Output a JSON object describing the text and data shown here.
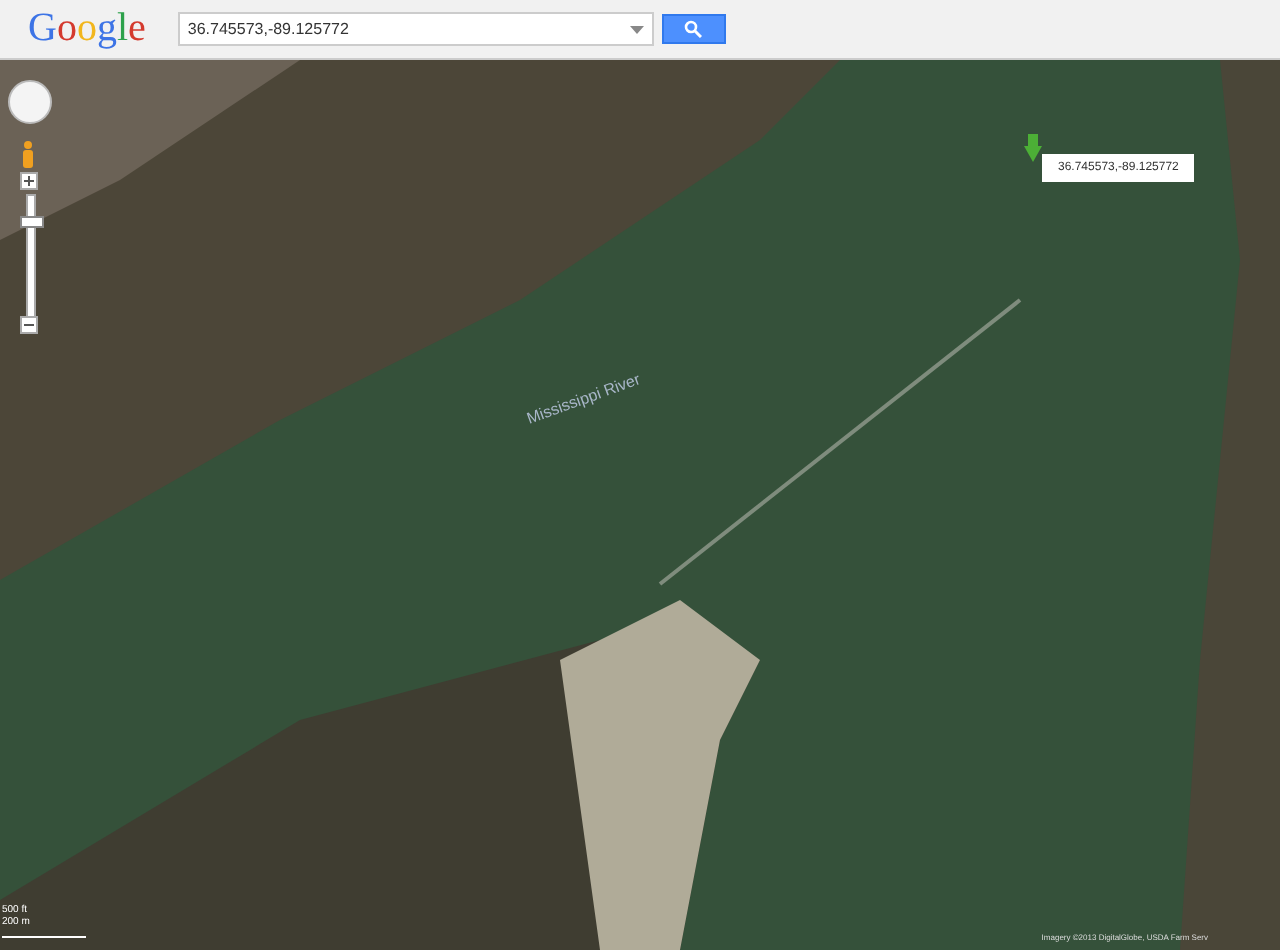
{
  "header": {
    "logo": "Google",
    "search": {
      "value": "36.745573,-89.125772"
    }
  },
  "map": {
    "zoom": {
      "level": 0.82
    },
    "label": "Mississippi River",
    "marker_label": "36.745573,-89.125772",
    "scale": [
      "500 ft",
      "200 m"
    ],
    "attribution": "Imagery ©2013 DigitalGlobe, USDA Farm Serv"
  }
}
